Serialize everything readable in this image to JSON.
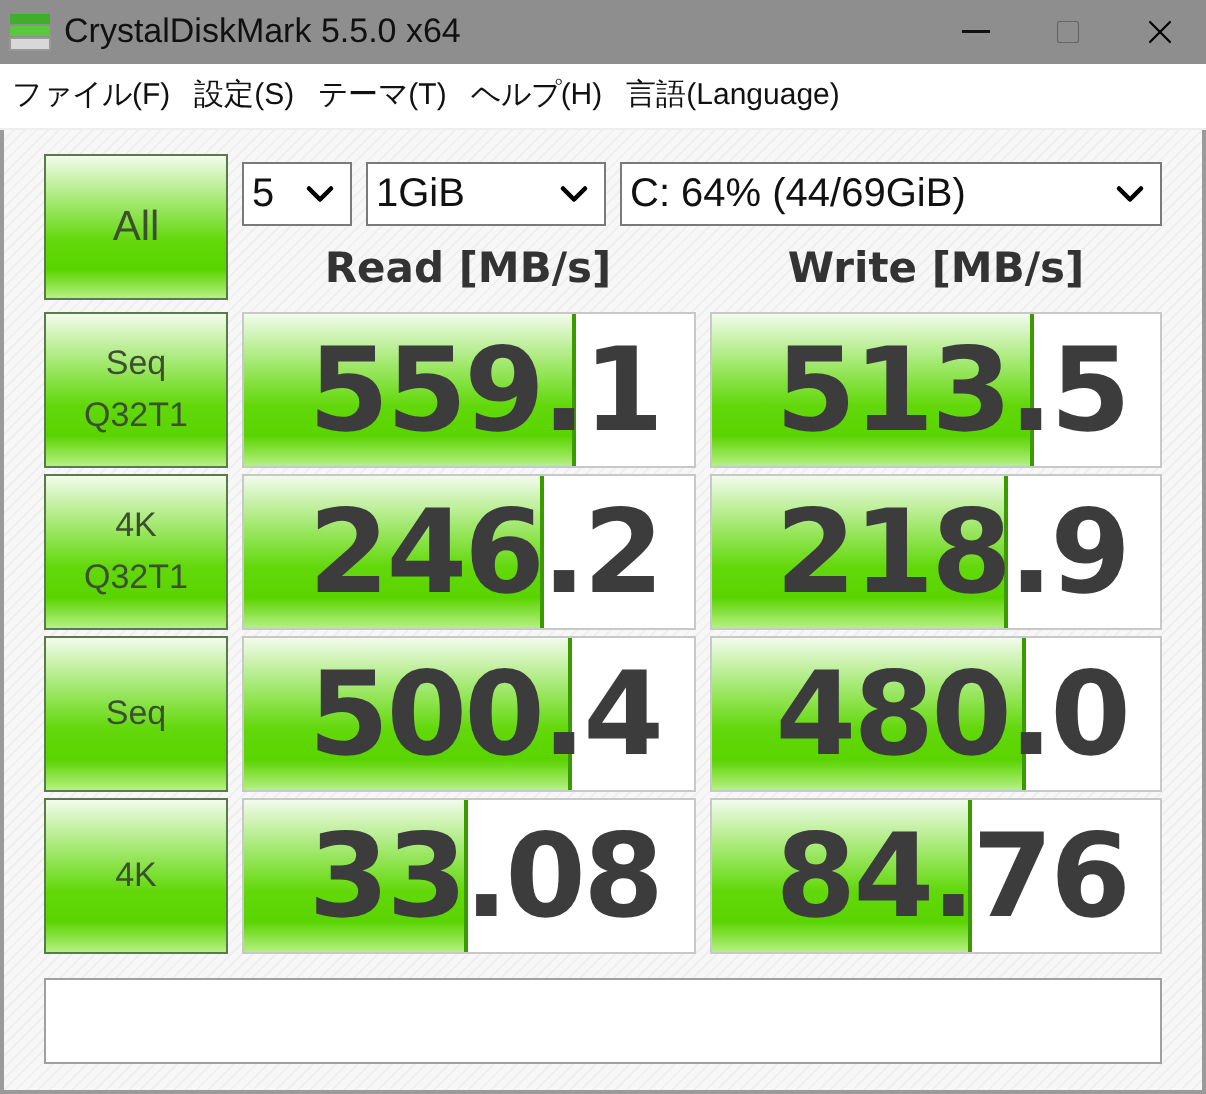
{
  "window": {
    "title": "CrystalDiskMark 5.5.0 x64"
  },
  "menu": [
    "ファイル(F)",
    "設定(S)",
    "テーマ(T)",
    "ヘルプ(H)",
    "言語(Language)"
  ],
  "all_button": "All",
  "dropdowns": [
    {
      "value": "5"
    },
    {
      "value": "1GiB"
    },
    {
      "value": "C: 64% (44/69GiB)"
    }
  ],
  "headers": [
    "Read [MB/s]",
    "Write [MB/s]"
  ],
  "rows": [
    {
      "label_lines": [
        "Seq",
        "Q32T1"
      ],
      "read": {
        "value": "559.1",
        "level": 0.74
      },
      "write": {
        "value": "513.5",
        "level": 0.72
      }
    },
    {
      "label_lines": [
        "4K",
        "Q32T1"
      ],
      "read": {
        "value": "246.2",
        "level": 0.67
      },
      "write": {
        "value": "218.9",
        "level": 0.66
      }
    },
    {
      "label_lines": [
        "Seq"
      ],
      "read": {
        "value": "500.4",
        "level": 0.73
      },
      "write": {
        "value": "480.0",
        "level": 0.7
      }
    },
    {
      "label_lines": [
        "4K"
      ],
      "read": {
        "value": "33.08",
        "level": 0.5
      },
      "write": {
        "value": "84.76",
        "level": 0.58
      }
    }
  ]
}
